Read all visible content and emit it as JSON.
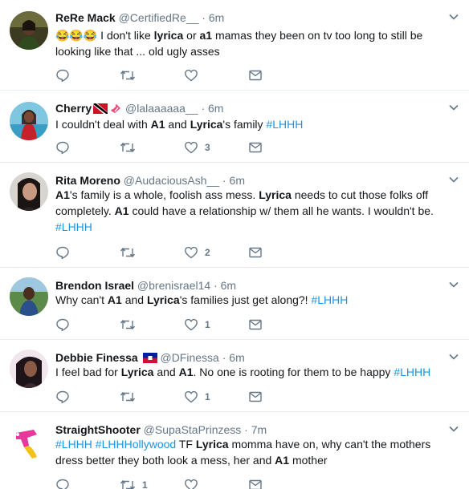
{
  "tweets": [
    {
      "name": "ReRe Mack",
      "handle": "@CertifiedRe__",
      "dot": "·",
      "time": "6m",
      "segments": [
        {
          "t": "😂😂😂 I don't like "
        },
        {
          "t": "lyrica",
          "s": "b"
        },
        {
          "t": " or "
        },
        {
          "t": "a1",
          "s": "b"
        },
        {
          "t": " mamas they been on tv too long to still be looking like that ... old ugly asses"
        }
      ],
      "reply_count": "",
      "retweet_count": "",
      "like_count": ""
    },
    {
      "name": "Cherry",
      "handle": "@lalaaaaaa__",
      "dot": "·",
      "time": "6m",
      "segments": [
        {
          "t": "I couldn't deal with "
        },
        {
          "t": "A1",
          "s": "b"
        },
        {
          "t": " and "
        },
        {
          "t": "Lyrica",
          "s": "b"
        },
        {
          "t": "'s family  "
        },
        {
          "t": "#LHHH",
          "s": "tag"
        }
      ],
      "reply_count": "",
      "retweet_count": "",
      "like_count": "3"
    },
    {
      "name": "Rita Moreno",
      "handle": "@AudaciousAsh__",
      "dot": "·",
      "time": "6m",
      "segments": [
        {
          "t": "A1",
          "s": "b"
        },
        {
          "t": "'s family is a whole, foolish ass mess. "
        },
        {
          "t": "Lyrica",
          "s": "b"
        },
        {
          "t": " needs to cut those folks off completely. "
        },
        {
          "t": "A1",
          "s": "b"
        },
        {
          "t": " could have a relationship w/ them all he wants. I wouldn't be. "
        },
        {
          "t": "#LHHH",
          "s": "tag"
        }
      ],
      "reply_count": "",
      "retweet_count": "",
      "like_count": "2"
    },
    {
      "name": "Brendon Israel",
      "handle": "@brenisrael14",
      "dot": "·",
      "time": "6m",
      "segments": [
        {
          "t": "Why can't "
        },
        {
          "t": "A1",
          "s": "b"
        },
        {
          "t": " and "
        },
        {
          "t": "Lyrica",
          "s": "b"
        },
        {
          "t": "'s families just get along?! "
        },
        {
          "t": "#LHHH",
          "s": "tag"
        }
      ],
      "reply_count": "",
      "retweet_count": "",
      "like_count": "1"
    },
    {
      "name": "Debbie Finessa",
      "handle": "@DFinessa",
      "dot": "·",
      "time": "6m",
      "segments": [
        {
          "t": "I feel bad for "
        },
        {
          "t": "Lyrica",
          "s": "b"
        },
        {
          "t": " and "
        },
        {
          "t": "A1",
          "s": "b"
        },
        {
          "t": ". No one is rooting for them to be happy "
        },
        {
          "t": "#LHHH",
          "s": "tag"
        }
      ],
      "reply_count": "",
      "retweet_count": "",
      "like_count": "1"
    },
    {
      "name": "StraightShooter",
      "handle": "@SupaStaPrinzess",
      "dot": "·",
      "time": "7m",
      "segments": [
        {
          "t": "#LHHH",
          "s": "tag"
        },
        {
          "t": " "
        },
        {
          "t": "#LHHHollywood",
          "s": "tag"
        },
        {
          "t": " TF "
        },
        {
          "t": "Lyrica",
          "s": "b"
        },
        {
          "t": " momma have on, why can't the mothers dress better they both look a mess, her and "
        },
        {
          "t": "A1",
          "s": "b"
        },
        {
          "t": " mother"
        }
      ],
      "reply_count": "",
      "retweet_count": "1",
      "like_count": ""
    }
  ],
  "colors": {
    "text": "#14171a",
    "muted": "#657786",
    "hashtag": "#1b95e0",
    "divider": "#e6ecf0"
  },
  "icons": {
    "reply": "reply-icon",
    "retweet": "retweet-icon",
    "like": "like-icon",
    "dm": "direct-message-icon",
    "caret": "chevron-down-icon"
  }
}
